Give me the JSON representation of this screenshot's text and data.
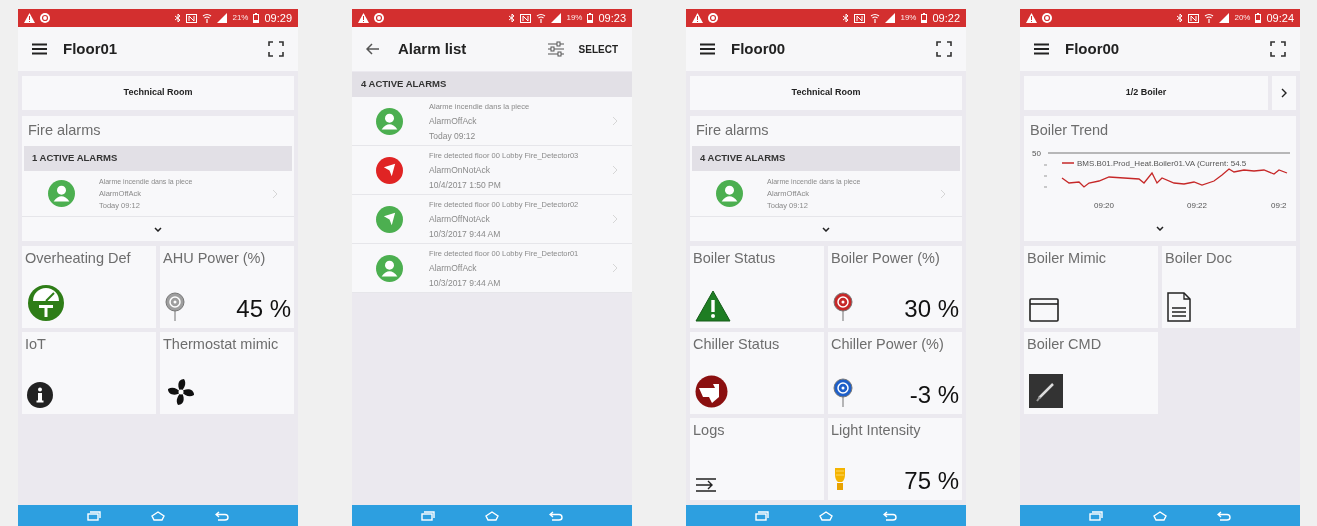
{
  "phones": [
    {
      "kind": "dashboard",
      "status_bar": {
        "battery": "21%",
        "time": "09:29"
      },
      "app_bar": {
        "title": "Floor01"
      },
      "tab_bar": {
        "label": "Technical Room",
        "next": false
      },
      "section": {
        "kind": "alarms",
        "title": "Fire alarms",
        "header": "1 ACTIVE ALARMS",
        "alarms": [
          {
            "kind": "person",
            "color": "#4caf50",
            "description": "Alarme incendie dans la piece",
            "state": "AlarmOffAck",
            "time": "Today 09:12"
          }
        ]
      },
      "tiles": [
        {
          "kind": "gauge",
          "title": "Overheating Def"
        },
        {
          "kind": "dial",
          "title": "AHU Power (%)",
          "color": "#9e9e9e",
          "value": "45 %"
        },
        {
          "kind": "info",
          "title": "IoT"
        },
        {
          "kind": "fan",
          "title": "Thermostat mimic"
        }
      ]
    },
    {
      "kind": "alarm_list",
      "status_bar": {
        "battery": "19%",
        "time": "09:23"
      },
      "app_bar": {
        "title": "Alarm list",
        "action": "SELECT"
      },
      "header": "4 ACTIVE ALARMS",
      "alarms": [
        {
          "kind": "person",
          "color": "#4caf50",
          "description": "Alarme incendie dans la piece",
          "state": "AlarmOffAck",
          "time": "Today 09:12"
        },
        {
          "kind": "bell",
          "color": "#e02424",
          "description": "Fire detected floor 00 Lobby Fire_Detector03",
          "state": "AlarmOnNotAck",
          "time": "10/4/2017 1:50 PM"
        },
        {
          "kind": "bell",
          "color": "#4caf50",
          "description": "Fire detected floor 00 Lobby Fire_Detector02",
          "state": "AlarmOffNotAck",
          "time": "10/3/2017 9:44 AM"
        },
        {
          "kind": "person",
          "color": "#4caf50",
          "description": "Fire detected floor 00 Lobby Fire_Detector01",
          "state": "AlarmOffAck",
          "time": "10/3/2017 9:44 AM"
        }
      ]
    },
    {
      "kind": "dashboard",
      "status_bar": {
        "battery": "19%",
        "time": "09:22"
      },
      "app_bar": {
        "title": "Floor00"
      },
      "tab_bar": {
        "label": "Technical Room",
        "next": false
      },
      "section": {
        "kind": "alarms",
        "title": "Fire alarms",
        "header": "4 ACTIVE ALARMS",
        "alarms": [
          {
            "kind": "person",
            "color": "#4caf50",
            "description": "Alarme incendie dans la piece",
            "state": "AlarmOffAck",
            "time": "Today 09:12"
          }
        ]
      },
      "tiles": [
        {
          "kind": "warning",
          "title": "Boiler Status"
        },
        {
          "kind": "dial",
          "title": "Boiler Power (%)",
          "color": "#c62828",
          "value": "30 %"
        },
        {
          "kind": "thumb",
          "title": "Chiller Status"
        },
        {
          "kind": "dial",
          "title": "Chiller Power (%)",
          "color": "#1e5fc8",
          "value": "-3 %"
        },
        {
          "kind": "log",
          "title": "Logs"
        },
        {
          "kind": "bulb",
          "title": "Light Intensity",
          "value": "75 %"
        }
      ]
    },
    {
      "kind": "dashboard",
      "status_bar": {
        "battery": "20%",
        "time": "09:24"
      },
      "app_bar": {
        "title": "Floor00"
      },
      "tab_bar": {
        "label": "1/2 Boiler",
        "next": true
      },
      "section": {
        "kind": "trend",
        "title": "Boiler Trend",
        "y_tick": "50",
        "legend": "BMS.B01.Prod_Heat.Boiler01.VA (Current: 54.5",
        "x_labels": [
          "09:20",
          "09:22",
          "09:2"
        ]
      },
      "tiles": [
        {
          "kind": "window",
          "title": "Boiler Mimic"
        },
        {
          "kind": "document",
          "title": "Boiler Doc"
        },
        {
          "kind": "command",
          "title": "Boiler CMD"
        }
      ]
    }
  ]
}
